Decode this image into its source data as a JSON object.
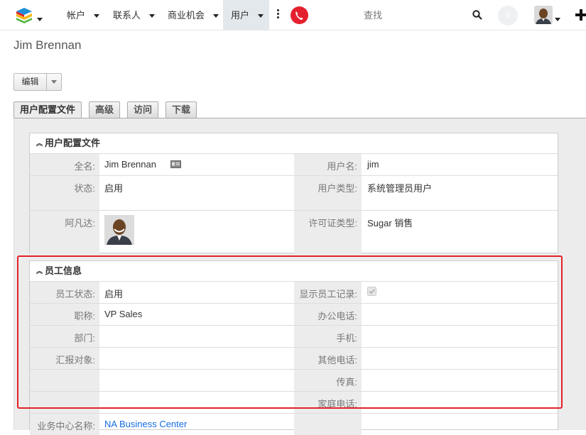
{
  "nav": {
    "items": [
      {
        "label": "帐户"
      },
      {
        "label": "联系人"
      },
      {
        "label": "商业机会"
      },
      {
        "label": "用户"
      }
    ],
    "search_placeholder": "查找",
    "notification_count": "0",
    "phone_color": "#e5202e"
  },
  "record": {
    "title": "Jim Brennan",
    "edit_label": "编辑"
  },
  "tabs": [
    {
      "label": "用户配置文件",
      "active": true
    },
    {
      "label": "高级"
    },
    {
      "label": "访问"
    },
    {
      "label": "下载"
    }
  ],
  "profile_panel": {
    "title": "用户配置文件",
    "full_name_label": "全名:",
    "full_name": "Jim Brennan",
    "username_label": "用户名:",
    "username": "jim",
    "status_label": "状态:",
    "status": "启用",
    "user_type_label": "用户类型:",
    "user_type": "系统管理员用户",
    "avatar_label": "阿凡达:",
    "license_label": "许可证类型:",
    "license": "Sugar 销售"
  },
  "employee_panel": {
    "title": "员工信息",
    "emp_status_label": "员工状态:",
    "emp_status": "启用",
    "show_record_label": "显示员工记录:",
    "show_record_checked": true,
    "title_label": "职称:",
    "job_title": "VP Sales",
    "office_phone_label": "办公电话:",
    "department_label": "部门:",
    "mobile_label": "手机:",
    "reports_to_label": "汇报对象:",
    "other_phone_label": "其他电话:",
    "fax_label": "传真:",
    "home_phone_label": "家庭电话:",
    "business_center_label": "业务中心名称:",
    "business_center": "NA Business Center"
  },
  "highlight_color": "#e3212a"
}
